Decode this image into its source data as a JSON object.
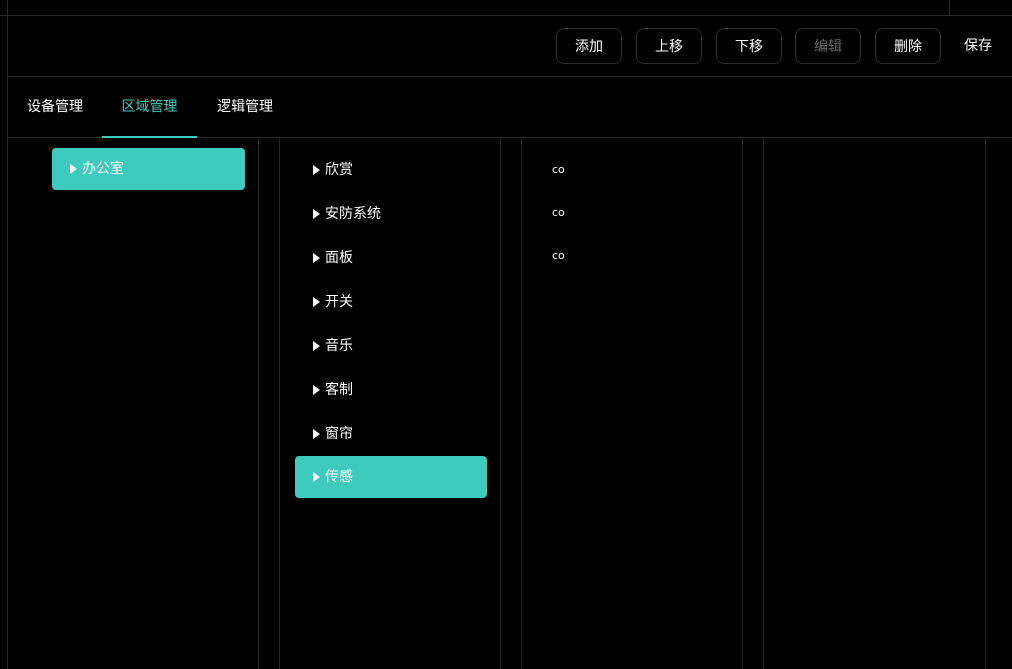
{
  "toolbar": {
    "add_label": "添加",
    "up_label": "上移",
    "down_label": "下移",
    "edit_label": "编辑",
    "delete_label": "删除",
    "save_label": "保存"
  },
  "tabs": [
    {
      "label": "设备管理",
      "active": false
    },
    {
      "label": "区域管理",
      "active": true
    },
    {
      "label": "逻辑管理",
      "active": false
    }
  ],
  "areas": [
    {
      "label": "办公室",
      "selected": true
    }
  ],
  "categories": [
    {
      "label": "欣赏",
      "selected": false
    },
    {
      "label": "安防系统",
      "selected": false
    },
    {
      "label": "面板",
      "selected": false
    },
    {
      "label": "开关",
      "selected": false
    },
    {
      "label": "音乐",
      "selected": false
    },
    {
      "label": "客制",
      "selected": false
    },
    {
      "label": "窗帘",
      "selected": false
    },
    {
      "label": "传感",
      "selected": true
    }
  ],
  "devices": [
    {
      "label": "co"
    },
    {
      "label": "co"
    },
    {
      "label": "co"
    }
  ],
  "colors": {
    "accent": "#3ecbbe",
    "background": "#000000",
    "border": "#262626",
    "disabled_text": "#6a6a6a"
  }
}
